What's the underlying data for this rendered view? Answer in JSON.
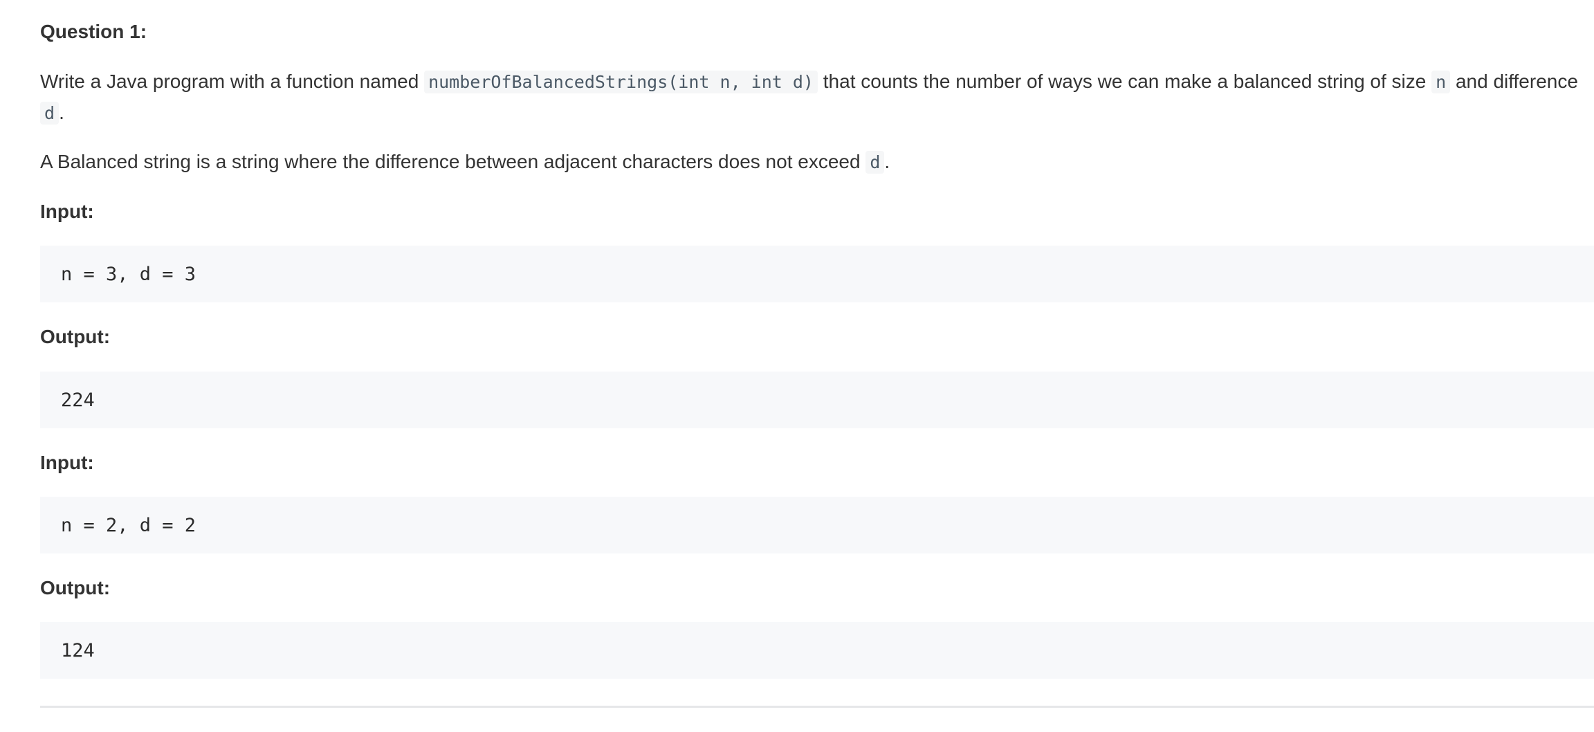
{
  "question_title": "Question 1:",
  "description": {
    "part1": "Write a Java program with a function named ",
    "function_signature": "numberOfBalancedStrings(int n, int d)",
    "part2": " that counts the number of ways we can make a balanced string of size ",
    "var_n": "n",
    "part3": " and difference ",
    "var_d": "d",
    "part4": "."
  },
  "definition": {
    "text": "A Balanced string is a string where the difference between adjacent characters does not exceed ",
    "var_d": "d",
    "end": "."
  },
  "examples": [
    {
      "input_label": "Input:",
      "input": "n = 3, d = 3",
      "output_label": "Output:",
      "output": "224"
    },
    {
      "input_label": "Input:",
      "input": "n = 2, d = 2",
      "output_label": "Output:",
      "output": "124"
    }
  ]
}
